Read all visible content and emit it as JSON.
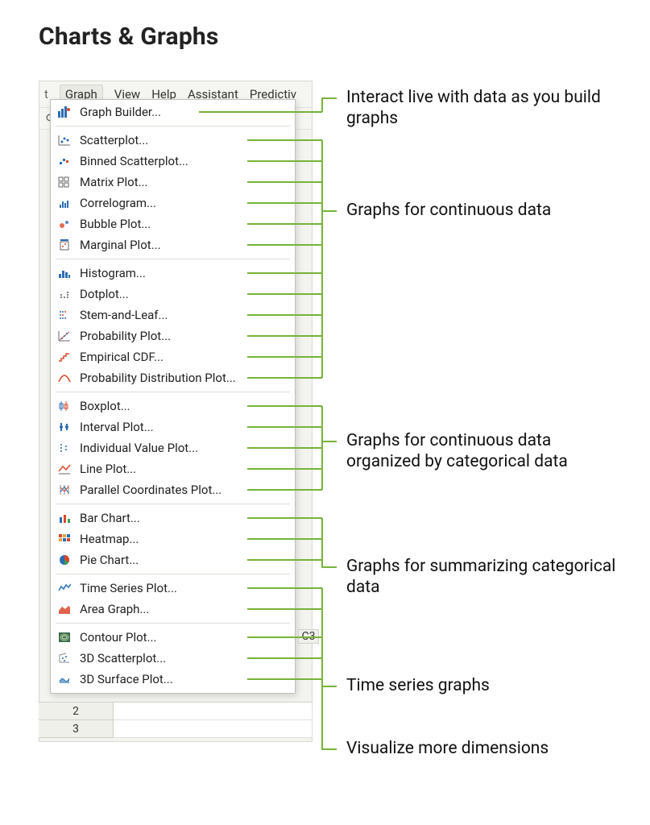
{
  "title": "Charts & Graphs",
  "menubar": {
    "frag_left": "t",
    "items": [
      "Graph",
      "View",
      "Help",
      "Assistant",
      "Predictiv"
    ],
    "selected": "Graph"
  },
  "toolbar": {
    "frag_icon_text": "⟳"
  },
  "cell_header": "C3",
  "sheet_rows": [
    "2",
    "3"
  ],
  "dropdown_groups": [
    {
      "items": [
        {
          "icon": "graph-builder-icon",
          "label": "Graph Builder..."
        }
      ]
    },
    {
      "items": [
        {
          "icon": "scatterplot-icon",
          "label": "Scatterplot..."
        },
        {
          "icon": "binned-scatterplot-icon",
          "label": "Binned Scatterplot..."
        },
        {
          "icon": "matrix-plot-icon",
          "label": "Matrix Plot..."
        },
        {
          "icon": "correlogram-icon",
          "label": "Correlogram..."
        },
        {
          "icon": "bubble-plot-icon",
          "label": "Bubble Plot..."
        },
        {
          "icon": "marginal-plot-icon",
          "label": "Marginal Plot..."
        }
      ]
    },
    {
      "items": [
        {
          "icon": "histogram-icon",
          "label": "Histogram..."
        },
        {
          "icon": "dotplot-icon",
          "label": "Dotplot..."
        },
        {
          "icon": "stem-and-leaf-icon",
          "label": "Stem-and-Leaf..."
        },
        {
          "icon": "probability-plot-icon",
          "label": "Probability Plot..."
        },
        {
          "icon": "empirical-cdf-icon",
          "label": "Empirical CDF..."
        },
        {
          "icon": "probability-distribution-icon",
          "label": "Probability Distribution Plot..."
        }
      ]
    },
    {
      "items": [
        {
          "icon": "boxplot-icon",
          "label": "Boxplot..."
        },
        {
          "icon": "interval-plot-icon",
          "label": "Interval Plot..."
        },
        {
          "icon": "individual-value-icon",
          "label": "Individual Value Plot..."
        },
        {
          "icon": "line-plot-icon",
          "label": "Line Plot..."
        },
        {
          "icon": "parallel-coordinates-icon",
          "label": "Parallel Coordinates Plot..."
        }
      ]
    },
    {
      "items": [
        {
          "icon": "bar-chart-icon",
          "label": "Bar Chart..."
        },
        {
          "icon": "heatmap-icon",
          "label": "Heatmap..."
        },
        {
          "icon": "pie-chart-icon",
          "label": "Pie Chart..."
        }
      ]
    },
    {
      "items": [
        {
          "icon": "time-series-icon",
          "label": "Time Series Plot..."
        },
        {
          "icon": "area-graph-icon",
          "label": "Area Graph..."
        }
      ]
    },
    {
      "items": [
        {
          "icon": "contour-plot-icon",
          "label": "Contour Plot..."
        },
        {
          "icon": "3d-scatterplot-icon",
          "label": "3D Scatterplot..."
        },
        {
          "icon": "3d-surface-plot-icon",
          "label": "3D Surface Plot..."
        }
      ]
    }
  ],
  "captions": {
    "c1": "Interact live with data as you build graphs",
    "c2": "Graphs for continuous data",
    "c3": "Graphs for continuous data organized by categorical data",
    "c4": "Graphs for summarizing categorical data",
    "c5": "Time series graphs",
    "c6": "Visualize more dimensions"
  },
  "colors": {
    "connector": "#77b33a"
  }
}
